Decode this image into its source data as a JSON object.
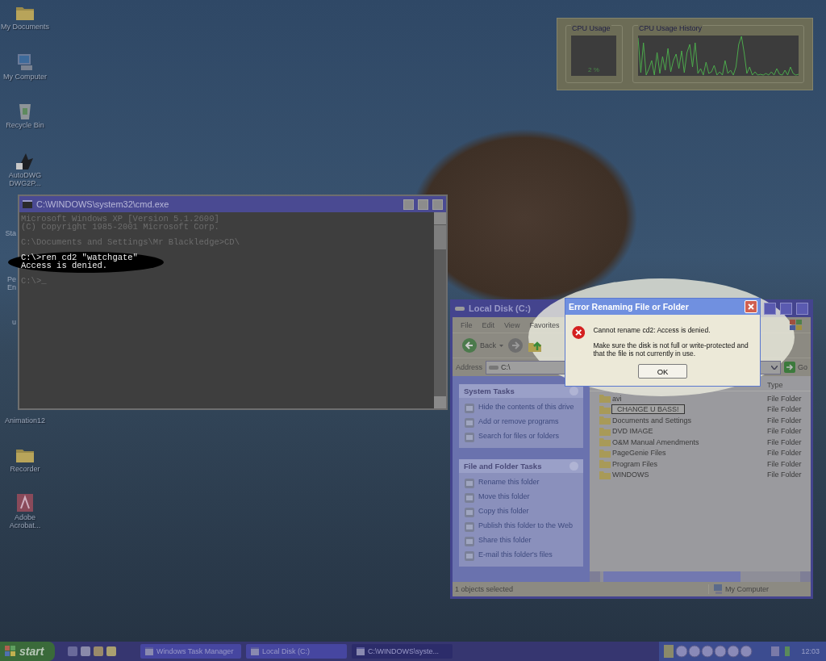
{
  "desktop_icons": [
    {
      "label": "My Documents",
      "kind": "folder"
    },
    {
      "label": "My Computer",
      "kind": "computer"
    },
    {
      "label": "Recycle Bin",
      "kind": "bin"
    },
    {
      "label": "AutoDWG DWG2P...",
      "kind": "app"
    },
    {
      "label": "Sta",
      "kind": "cut"
    },
    {
      "label": "Pe En",
      "kind": "cut"
    },
    {
      "label": "u",
      "kind": "cut"
    },
    {
      "label": "Animation12",
      "kind": "label"
    },
    {
      "label": "Recorder",
      "kind": "folder"
    },
    {
      "label": "Adobe Acrobat...",
      "kind": "acrobat"
    }
  ],
  "task_manager_widget": {
    "cpu_usage": {
      "title": "CPU Usage",
      "reading": "2 %"
    },
    "cpu_history": {
      "title": "CPU Usage History"
    }
  },
  "cmd_window": {
    "title": "C:\\WINDOWS\\system32\\cmd.exe",
    "blocks": [
      {
        "highlighted": false,
        "lines": [
          "Microsoft Windows XP [Version 5.1.2600]",
          "(C) Copyright 1985-2001 Microsoft Corp."
        ]
      },
      {
        "highlighted": false,
        "lines": [
          "C:\\Documents and Settings\\Mr Blackledge>CD\\"
        ]
      },
      {
        "highlighted": true,
        "lines": [
          "C:\\>ren cd2 \"watchgate\"",
          "Access is denied."
        ]
      },
      {
        "highlighted": false,
        "lines": [
          "C:\\>_"
        ]
      }
    ]
  },
  "explorer_window": {
    "title": "Local Disk (C:)",
    "menu": [
      "File",
      "Edit",
      "View",
      "Favorites"
    ],
    "back_button": "Back",
    "address_label": "Address",
    "address_value": "C:\\",
    "go_button": "Go",
    "task_panels": [
      {
        "title": "System Tasks",
        "items": [
          "Hide the contents of this drive",
          "Add or remove programs",
          "Search for files or folders"
        ]
      },
      {
        "title": "File and Folder Tasks",
        "items": [
          "Rename this folder",
          "Move this folder",
          "Copy this folder",
          "Publish this folder to the Web",
          "Share this folder",
          "E-mail this folder's files"
        ]
      }
    ],
    "column_header": "Type",
    "files": [
      {
        "name": "avi",
        "type": "File Folder",
        "renaming": false
      },
      {
        "name": "CHANGE U BASS!",
        "type": "File Folder",
        "renaming": true
      },
      {
        "name": "Documents and Settings",
        "type": "File Folder",
        "renaming": false
      },
      {
        "name": "DVD IMAGE",
        "type": "File Folder",
        "renaming": false
      },
      {
        "name": "O&M Manual Amendments",
        "type": "File Folder",
        "renaming": false
      },
      {
        "name": "PageGenie Files",
        "type": "File Folder",
        "renaming": false
      },
      {
        "name": "Program Files",
        "type": "File Folder",
        "renaming": false
      },
      {
        "name": "WINDOWS",
        "type": "File Folder",
        "renaming": false
      }
    ],
    "status": "1 objects selected",
    "status_zone": "My Computer"
  },
  "error_dialog": {
    "title": "Error Renaming File or Folder",
    "message": "Cannot rename cd2: Access is denied.",
    "detail": "Make sure the disk is not full or write-protected and that the file is not currently in use.",
    "button": "OK"
  },
  "taskbar": {
    "start": "start",
    "tasks": [
      {
        "label": "Windows Task Manager",
        "selected": false
      },
      {
        "label": "Local Disk (C:)",
        "selected": false
      },
      {
        "label": "C:\\WINDOWS\\syste...",
        "selected": true
      }
    ],
    "clock": "12:03"
  }
}
